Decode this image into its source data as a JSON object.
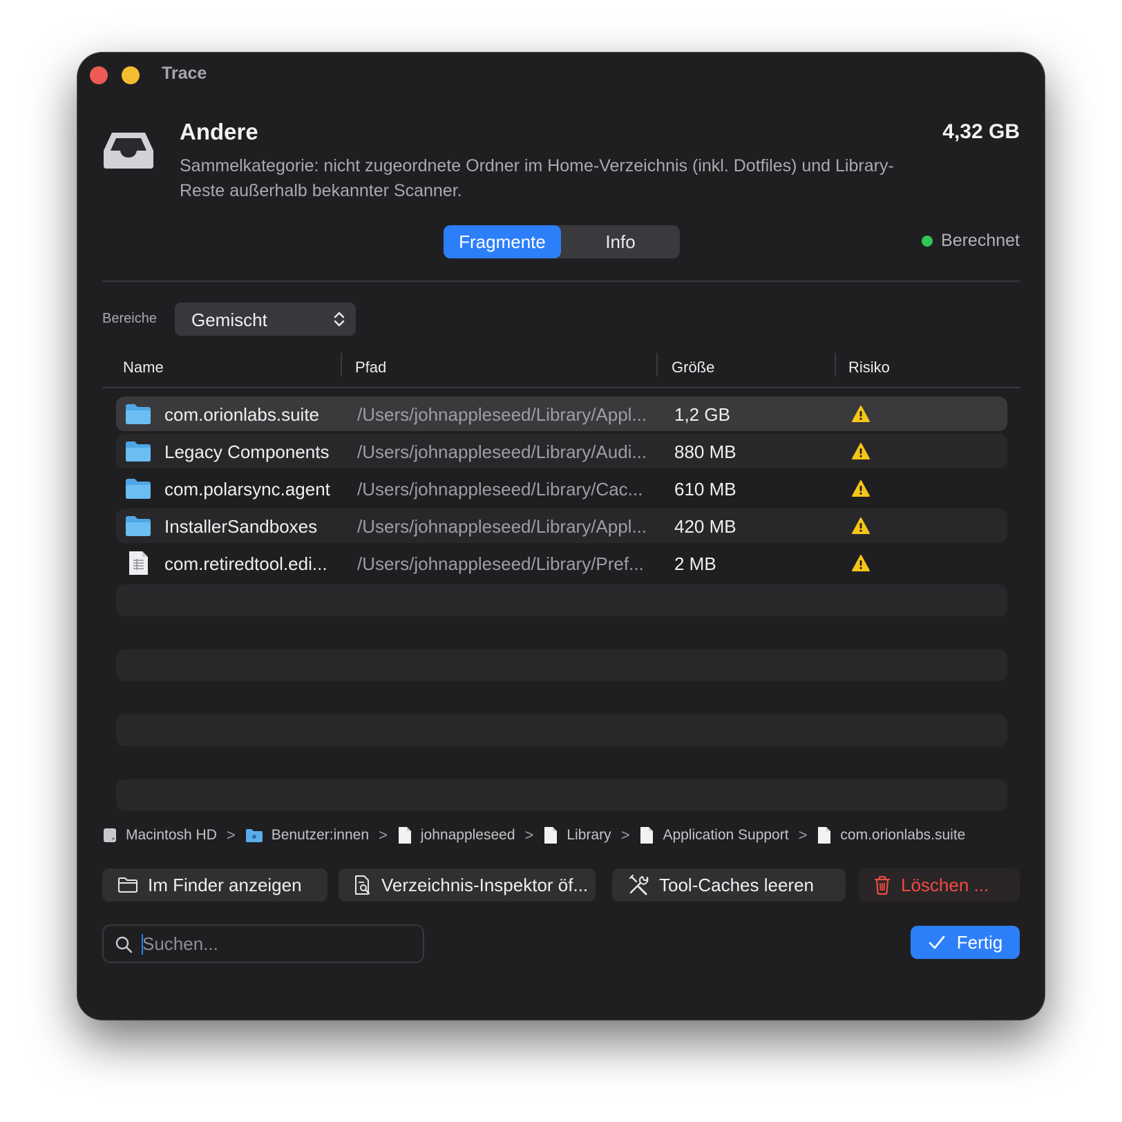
{
  "window": {
    "title": "Trace"
  },
  "category": {
    "title": "Andere",
    "description": "Sammelkategorie: nicht zugeordnete Ordner im Home-Verzeichnis (inkl. Dotfiles) und Library-Reste außerhalb bekannter Scanner.",
    "size": "4,32 GB",
    "icon": "tray-icon"
  },
  "tabs": [
    {
      "label": "Fragmente",
      "selected": true
    },
    {
      "label": "Info",
      "selected": false
    }
  ],
  "status": {
    "label": "Berechnet",
    "color": "#31c655"
  },
  "range": {
    "label": "Bereiche",
    "value": "Gemischt"
  },
  "table": {
    "columns": [
      "Name",
      "Pfad",
      "Größe",
      "Risiko"
    ],
    "rows": [
      {
        "name": "com.orionlabs.suite",
        "path": "/Users/johnappleseed/Library/Appl...",
        "size": "1,2 GB",
        "icon": "folder-icon",
        "risk": "warning-icon",
        "selected": true
      },
      {
        "name": "Legacy Components",
        "path": "/Users/johnappleseed/Library/Audi...",
        "size": "880 MB",
        "icon": "folder-icon",
        "risk": "warning-icon"
      },
      {
        "name": "com.polarsync.agent",
        "path": "/Users/johnappleseed/Library/Cac...",
        "size": "610 MB",
        "icon": "folder-icon",
        "risk": "warning-icon"
      },
      {
        "name": "InstallerSandboxes",
        "path": "/Users/johnappleseed/Library/Appl...",
        "size": "420 MB",
        "icon": "folder-icon",
        "risk": "warning-icon"
      },
      {
        "name": "com.retiredtool.edi...",
        "path": "/Users/johnappleseed/Library/Pref...",
        "size": "2 MB",
        "icon": "document-icon",
        "risk": "warning-icon"
      }
    ]
  },
  "breadcrumb": [
    {
      "label": "Macintosh HD",
      "icon": "disk-icon"
    },
    {
      "label": "Benutzer:innen",
      "icon": "folder-icon"
    },
    {
      "label": "johnappleseed",
      "icon": "document-icon"
    },
    {
      "label": "Library",
      "icon": "document-icon"
    },
    {
      "label": "Application Support",
      "icon": "document-icon"
    },
    {
      "label": "com.orionlabs.suite",
      "icon": "document-icon"
    }
  ],
  "actions": {
    "finder": "Im Finder anzeigen",
    "inspector": "Verzeichnis-Inspektor öf...",
    "caches": "Tool-Caches leeren",
    "delete": "Löschen ..."
  },
  "search": {
    "placeholder": "Suchen..."
  },
  "done": {
    "label": "Fertig"
  },
  "colors": {
    "accent": "#2d7ff9",
    "danger": "#f04c43",
    "warning": "#f5c518",
    "folder": "#5aaeea"
  }
}
